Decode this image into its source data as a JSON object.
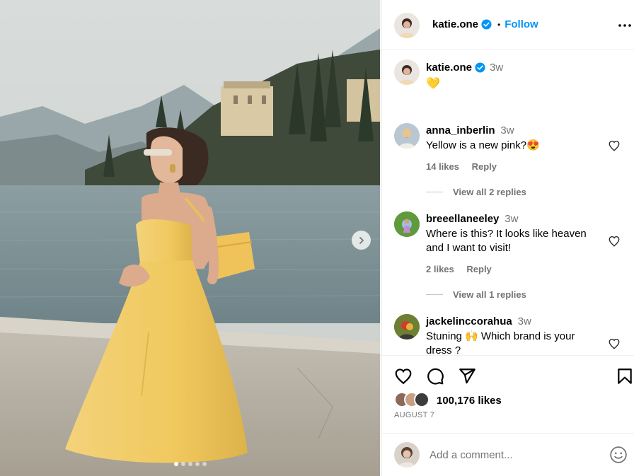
{
  "post": {
    "username": "katie.one",
    "follow_label": "Follow",
    "separator": "•",
    "carousel": {
      "total": 5,
      "active": 0
    }
  },
  "caption": {
    "username": "katie.one",
    "time": "3w",
    "text": "💛"
  },
  "comments": [
    {
      "username": "anna_inberlin",
      "time": "3w",
      "text": "Yellow is a new pink?😍",
      "likes": "14 likes",
      "reply_label": "Reply",
      "view_replies": "View all 2 replies"
    },
    {
      "username": "breeellaneeley",
      "time": "3w",
      "text": "Where is this? It looks like heaven and I want to visit!",
      "likes": "2 likes",
      "reply_label": "Reply",
      "view_replies": "View all 1 replies"
    },
    {
      "username": "jackelinccorahua",
      "time": "3w",
      "text": "Stuning 🙌 Which brand is your dress ?"
    }
  ],
  "footer": {
    "likes": "100,176 likes",
    "date": "AUGUST 7",
    "comment_placeholder": "Add a comment..."
  },
  "icons": {
    "more": "more-options-icon",
    "verified": "verified-badge-icon",
    "like": "heart-icon",
    "comment": "comment-icon",
    "share": "share-icon",
    "save": "bookmark-icon",
    "emoji": "emoji-icon",
    "next": "chevron-right-icon"
  },
  "colors": {
    "accent": "#0095f6",
    "verified": "#0095f6",
    "muted": "#737373",
    "dress": "#f2cf6b"
  }
}
